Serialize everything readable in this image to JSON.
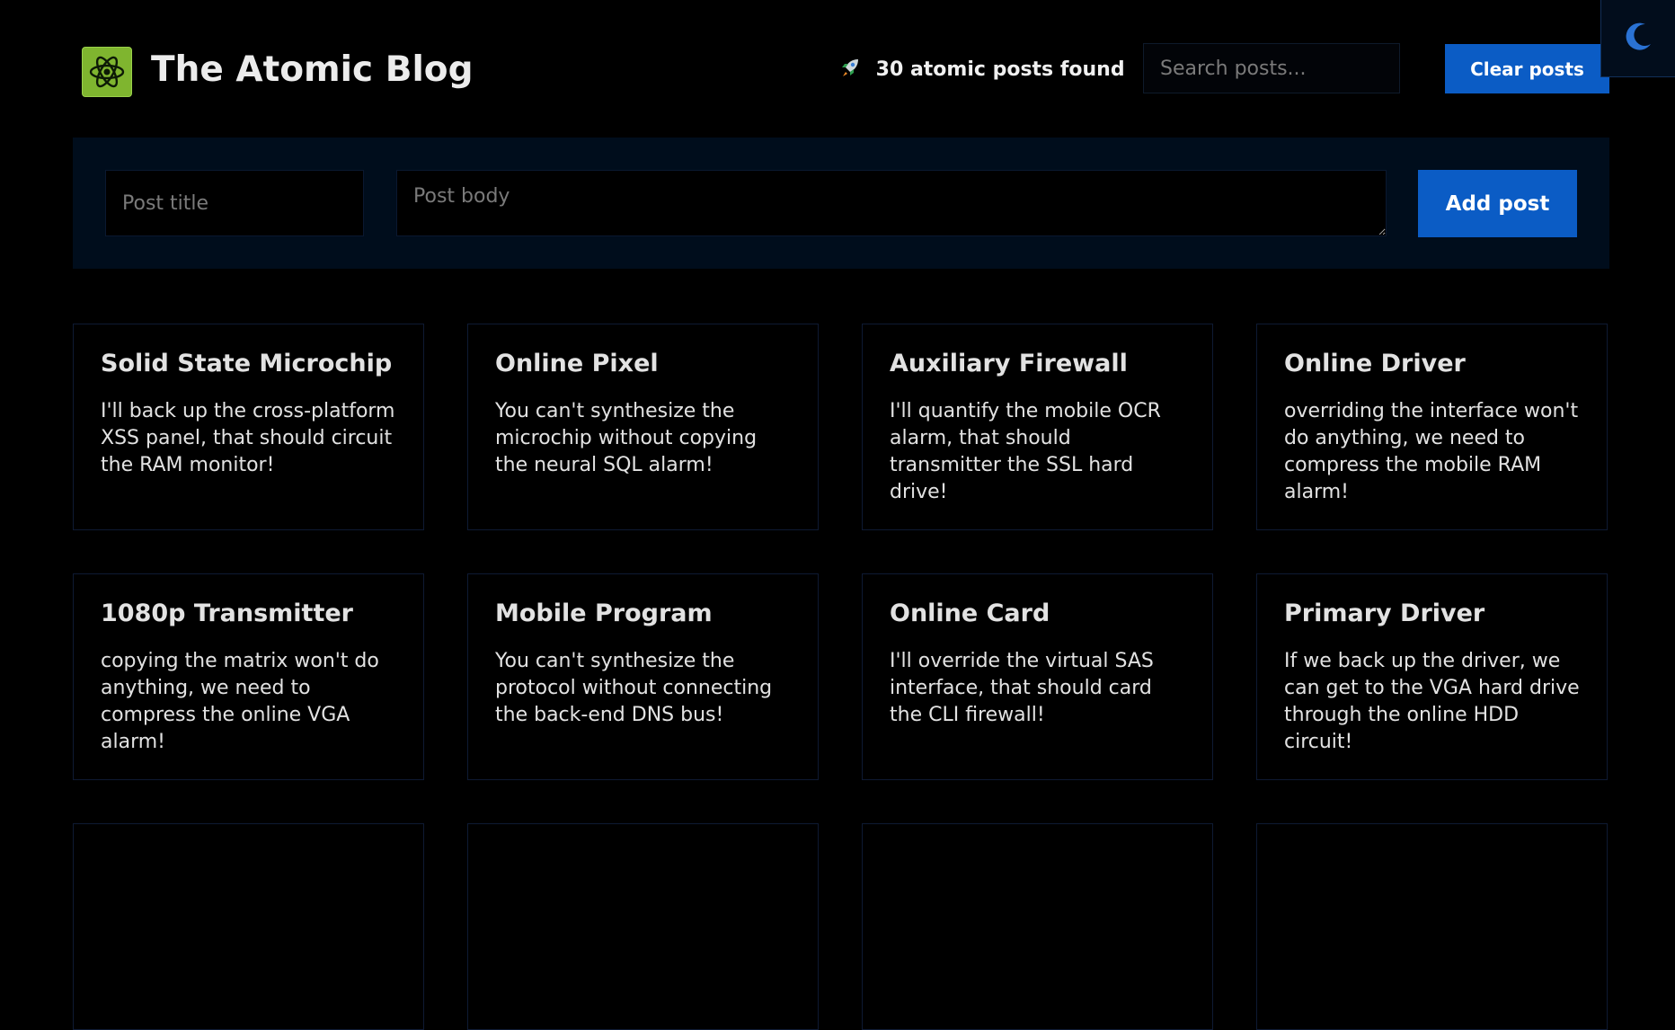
{
  "header": {
    "title": "The Atomic Blog",
    "logo_icon": "atom-icon",
    "posts_found_text": "30 atomic posts found",
    "search_placeholder": "Search posts...",
    "clear_label": "Clear posts",
    "theme_icon": "moon-icon"
  },
  "form": {
    "title_placeholder": "Post title",
    "body_placeholder": "Post body",
    "add_label": "Add post"
  },
  "posts": [
    {
      "title": "Solid State Microchip",
      "body": "I'll back up the cross-platform XSS panel, that should circuit the RAM monitor!"
    },
    {
      "title": "Online Pixel",
      "body": "You can't synthesize the microchip without copying the neural SQL alarm!"
    },
    {
      "title": "Auxiliary Firewall",
      "body": "I'll quantify the mobile OCR alarm, that should transmitter the SSL hard drive!"
    },
    {
      "title": "Online Driver",
      "body": "overriding the interface won't do anything, we need to compress the mobile RAM alarm!"
    },
    {
      "title": "1080p Transmitter",
      "body": "copying the matrix won't do anything, we need to compress the online VGA alarm!"
    },
    {
      "title": "Mobile Program",
      "body": "You can't synthesize the protocol without connecting the back-end DNS bus!"
    },
    {
      "title": "Online Card",
      "body": "I'll override the virtual SAS interface, that should card the CLI firewall!"
    },
    {
      "title": "Primary Driver",
      "body": "If we back up the driver, we can get to the VGA hard drive through the online HDD circuit!"
    },
    {
      "title": "",
      "body": ""
    },
    {
      "title": "",
      "body": ""
    },
    {
      "title": "",
      "body": ""
    },
    {
      "title": "",
      "body": ""
    }
  ],
  "colors": {
    "background": "#000000",
    "accent": "#0b5cc5",
    "panel": "#000d1c",
    "logo": "#7fb52f"
  }
}
